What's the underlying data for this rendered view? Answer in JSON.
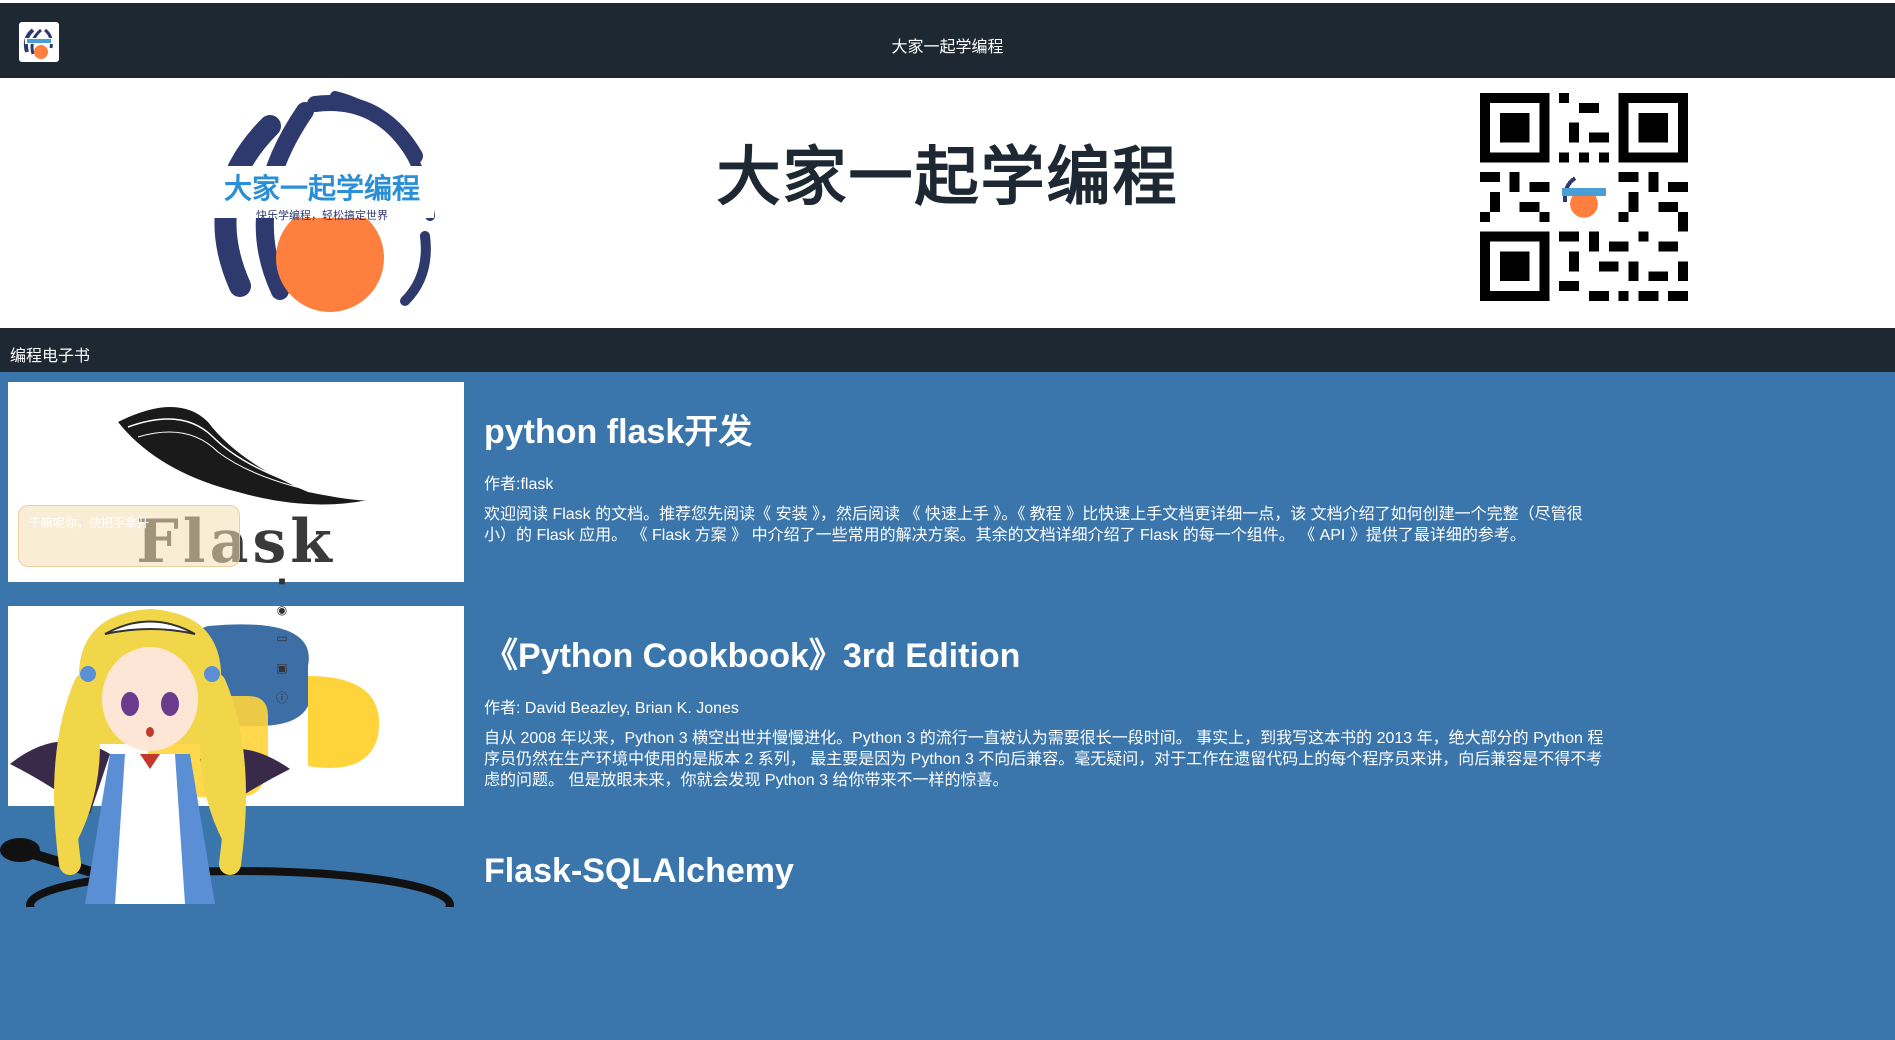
{
  "navbar": {
    "title": "大家一起学编程"
  },
  "banner": {
    "title": "大家一起学编程",
    "logo_text": "大家一起学编程",
    "logo_slogan": "快乐学编程，轻松搞定世界"
  },
  "category": {
    "title": "编程电子书"
  },
  "books": [
    {
      "title": "python flask开发",
      "author": "作者:flask",
      "description": "欢迎阅读 Flask 的文档。推荐您先阅读《 安装 》，然后阅读 《 快速上手 》。《 教程 》比快速上手文档更详细一点，该 文档介绍了如何创建一个完整（尽管很小）的 Flask 应用。 《 Flask 方案 》 中介绍了一些常用的解决方案。其余的文档详细介绍了 Flask 的每一个组件。 《 API 》提供了最详细的参考。",
      "cover_text": "Flask"
    },
    {
      "title": "《Python Cookbook》3rd Edition",
      "author": "作者: David Beazley, Brian K. Jones",
      "description": "自从 2008 年以来，Python 3 横空出世并慢慢进化。Python 3 的流行一直被认为需要很长一段时间。 事实上，到我写这本书的 2013 年，绝大部分的 Python 程序员仍然在生产环境中使用的是版本 2 系列， 最主要是因为 Python 3 不向后兼容。毫无疑问，对于工作在遗留代码上的每个程序员来讲，向后兼容是不得不考虑的问题。 但是放眼未来，你就会发现 Python 3 给你带来不一样的惊喜。"
    },
    {
      "title": "Flask-SQLAlchemy",
      "author": "",
      "description": ""
    }
  ],
  "mascot": {
    "toast_text": "干嘛呢你，快把手拿开"
  },
  "colors": {
    "navbar": "#1e2833",
    "content_bg": "#3a75ab",
    "accent_orange": "#ff7f3f",
    "logo_navy": "#2e3a6e"
  }
}
